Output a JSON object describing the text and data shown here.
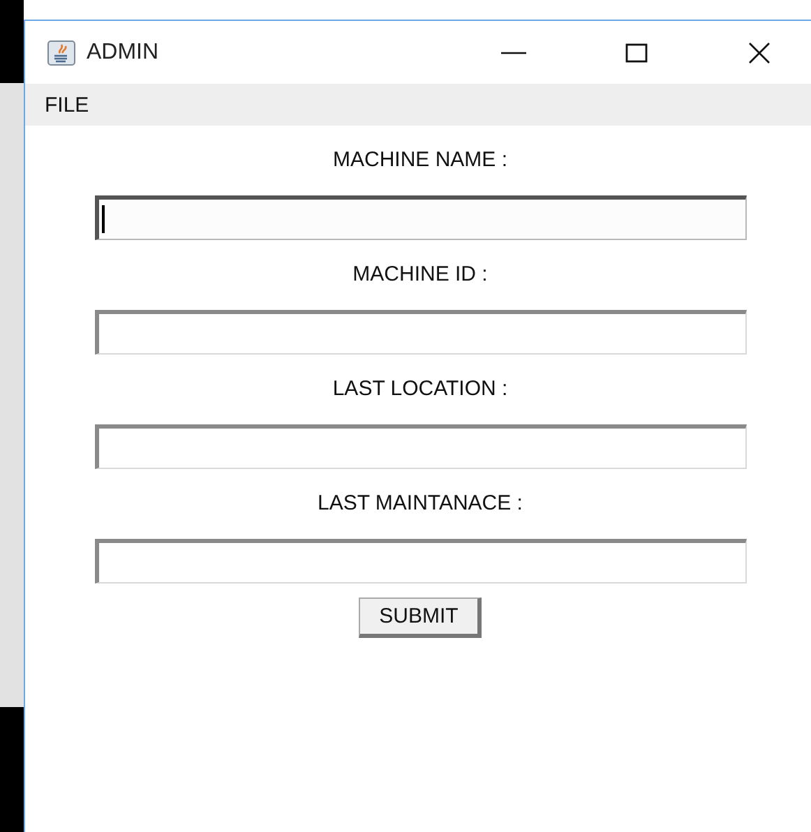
{
  "window": {
    "title": "ADMIN"
  },
  "menu": [
    "FILE"
  ],
  "fields": [
    {
      "label": "MACHINE NAME :",
      "focused": true
    },
    {
      "label": "MACHINE ID :",
      "focused": false
    },
    {
      "label": "LAST LOCATION :",
      "focused": false
    },
    {
      "label": "LAST MAINTANACE :",
      "focused": false
    }
  ],
  "submit": "SUBMIT"
}
